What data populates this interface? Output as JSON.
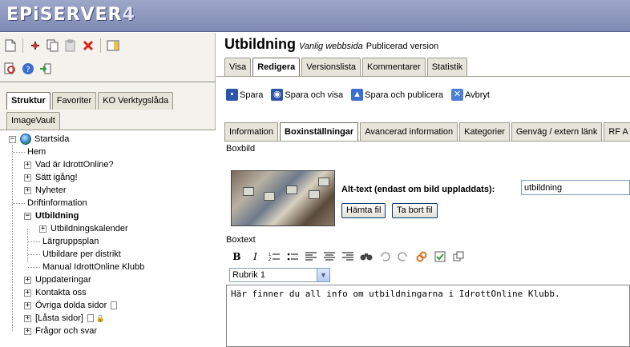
{
  "app": {
    "logo": "EPiSERVER",
    "logo_version": "4"
  },
  "left_toolbar": {
    "row1": [
      "new-page-icon",
      "move-icon",
      "copy-icon",
      "paste-icon",
      "delete-icon",
      "panel-icon"
    ],
    "row2": [
      "preview-icon",
      "help-icon",
      "export-icon"
    ]
  },
  "left_tabs": [
    "Struktur",
    "Favoriter",
    "KO Verktygslåda"
  ],
  "left_tab2": "ImageVault",
  "tree": {
    "root": "Startsida",
    "items": [
      {
        "label": "Hem"
      },
      {
        "label": "Vad är IdrottOnline?"
      },
      {
        "label": "Sätt igång!"
      },
      {
        "label": "Nyheter"
      },
      {
        "label": "Driftinformation"
      },
      {
        "label": "Utbildning"
      },
      {
        "label": "Utbildningskalender"
      },
      {
        "label": "Lärgruppsplan"
      },
      {
        "label": "Utbildare per distrikt"
      },
      {
        "label": "Manual IdrottOnline Klubb"
      },
      {
        "label": "Uppdateringar"
      },
      {
        "label": "Kontakta oss"
      },
      {
        "label": "Övriga dolda sidor"
      },
      {
        "label": "[Låsta sidor]"
      },
      {
        "label": "Frågor och svar"
      }
    ]
  },
  "page": {
    "title": "Utbildning",
    "page_type": "Vanlig webbsida",
    "status": "Publicerad version"
  },
  "tabs": [
    "Visa",
    "Redigera",
    "Versionslista",
    "Kommentarer",
    "Statistik"
  ],
  "actions": [
    "Spara",
    "Spara och visa",
    "Spara och publicera",
    "Avbryt"
  ],
  "subtabs": [
    "Information",
    "Boxinställningar",
    "Avancerad information",
    "Kategorier",
    "Genväg / extern länk",
    "RF A"
  ],
  "box": {
    "image_label": "Boxbild",
    "alt_label": "Alt-text (endast om bild uppladdats):",
    "alt_value": "utbildning",
    "fetch_button": "Hämta fil",
    "remove_button": "Ta bort fil",
    "text_label": "Boxtext",
    "format_value": "Rubrik 1",
    "editor_text": "Här finner du all info om utbildningarna i IdrottOnline Klubb."
  },
  "colors": {
    "header": "#8b95bd",
    "panel": "#f3f2ec"
  }
}
